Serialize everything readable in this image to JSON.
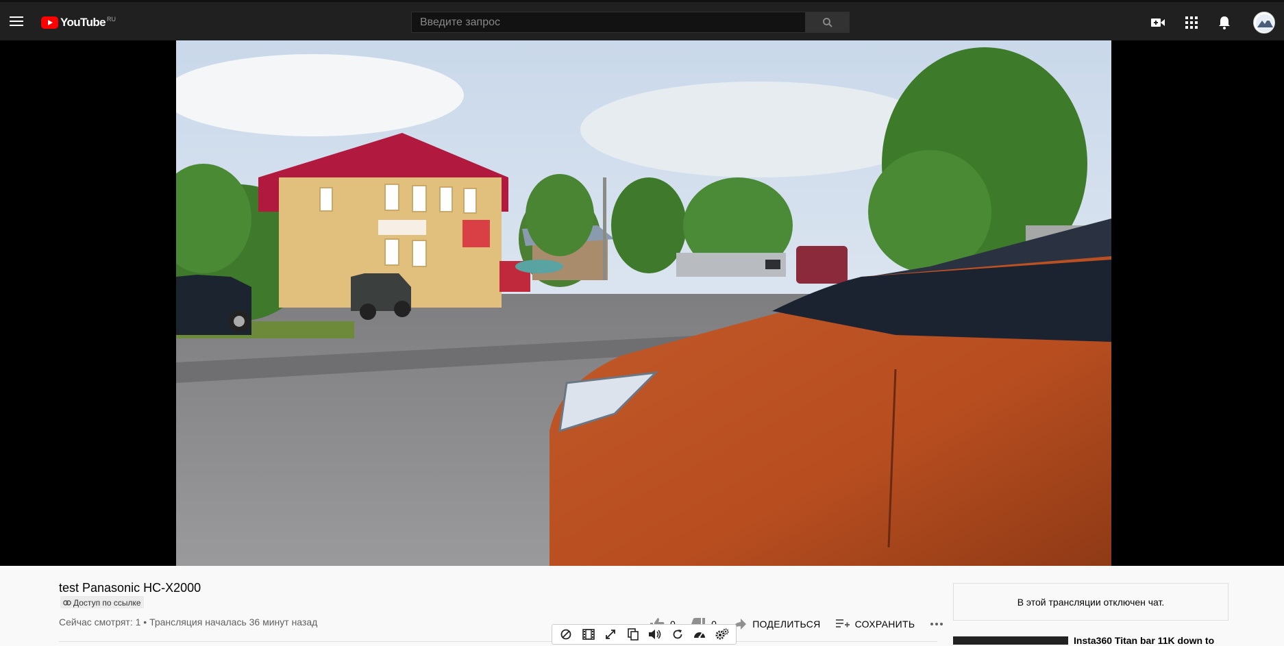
{
  "header": {
    "logo_text": "YouTube",
    "logo_region": "RU",
    "search_placeholder": "Введите запрос"
  },
  "video": {
    "title": "test Panasonic HC-X2000",
    "access_label": "Доступ по ссылке",
    "meta": "Сейчас смотрят: 1 • Трансляция началась 36 минут назад"
  },
  "actions": {
    "likes": "0",
    "dislikes": "0",
    "share_label": "ПОДЕЛИТЬСЯ",
    "save_label": "СОХРАНИТЬ"
  },
  "sidebar": {
    "chat_disabled": "В этой трансляции отключен чат.",
    "rec_title": "Insta360 Titan bar 11K down to"
  },
  "colors": {
    "brand": "#ff0000",
    "header_bg": "#202020",
    "page_bg": "#f9f9f9"
  }
}
